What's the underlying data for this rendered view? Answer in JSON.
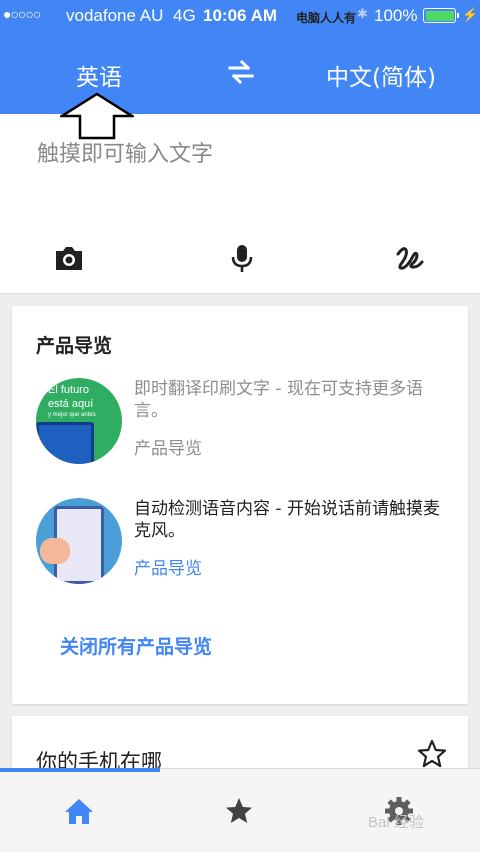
{
  "status_bar": {
    "signal": "●○○○○",
    "carrier": "vodafone AU",
    "network": "4G",
    "time": "10:06 AM",
    "watermark": "电脑人人有",
    "battery": "100%"
  },
  "header": {
    "source_language": "英语",
    "target_language": "中文(简体)",
    "swap_icon": "swap-arrows-icon",
    "annotation": "up-arrow-annotation"
  },
  "input": {
    "placeholder": "触摸即可输入文字",
    "tools": [
      "camera-icon",
      "microphone-icon",
      "handwriting-icon"
    ]
  },
  "product_tour": {
    "title": "产品导览",
    "items": [
      {
        "description": "即时翻译印刷文字 - 现在可支持更多语言。",
        "link": "产品导览",
        "thumbnail_text": [
          "El futuro",
          "está aquí",
          "y mejor que antes"
        ]
      },
      {
        "description": "自动检测语音内容 - 开始说话前请触摸麦克风。",
        "link": "产品导览"
      }
    ],
    "close_all": "关闭所有产品导览"
  },
  "find_phone": {
    "title": "你的手机在哪"
  },
  "bottom_nav": {
    "items": [
      "home-icon",
      "star-icon",
      "gear-icon"
    ],
    "watermark": "Bai 经验"
  },
  "colors": {
    "primary": "#4285f4",
    "muted_text": "#8d8d8d",
    "battery": "#4cd964"
  }
}
